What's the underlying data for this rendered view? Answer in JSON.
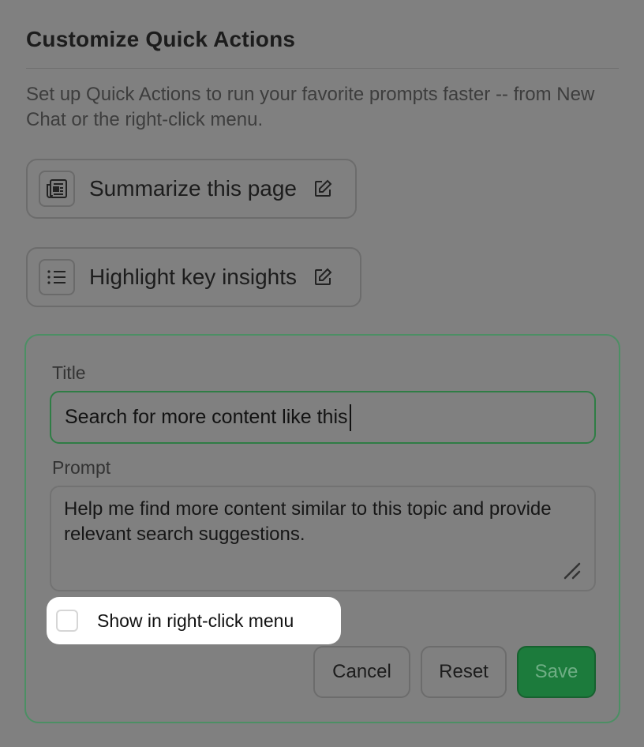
{
  "header": {
    "title": "Customize Quick Actions",
    "description": "Set up Quick Actions to run your favorite prompts faster -- from New Chat or the right-click menu."
  },
  "quick_actions": [
    {
      "label": "Summarize this page",
      "icon": "newspaper-icon"
    },
    {
      "label": "Highlight key insights",
      "icon": "list-icon"
    }
  ],
  "editor": {
    "title_label": "Title",
    "title_value": "Search for more content like this",
    "prompt_label": "Prompt",
    "prompt_value": "Help me find more content similar to this topic and provide relevant search suggestions.",
    "checkbox_label": "Show in right-click menu",
    "checkbox_checked": false,
    "buttons": {
      "cancel": "Cancel",
      "reset": "Reset",
      "save": "Save"
    }
  },
  "colors": {
    "overlay": "#808080",
    "accent_green": "#1c7b3c",
    "editor_border": "#4c8f64"
  }
}
